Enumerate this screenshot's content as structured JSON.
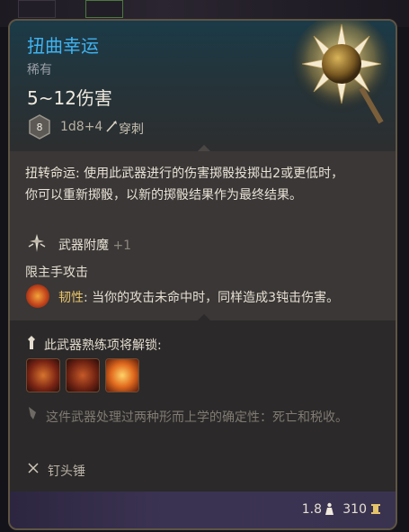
{
  "item": {
    "name": "扭曲幸运",
    "rarity": "稀有",
    "damage": "5~12伤害",
    "die_value": "8",
    "damage_dice": "1d8+4",
    "damage_type": "穿刺"
  },
  "passive": {
    "name": "扭转命运",
    "text": ": 使用此武器进行的伤害掷骰投掷出2或更低时，你可以重新掷骰，以新的掷骰结果作为最终结果。"
  },
  "enchantment": {
    "label": "武器附魔",
    "value": "+1"
  },
  "main_hand": "限主手攻击",
  "toughness": {
    "name": "韧性",
    "text": ": 当你的攻击未命中时，同样造成3钝击伤害。"
  },
  "proficiency": {
    "title": "此武器熟练项将解锁:"
  },
  "flavor": "这件武器处理过两种形而上学的确定性：死亡和税收。",
  "weapon_type": "钉头锤",
  "footer": {
    "weight": "1.8",
    "price": "310"
  },
  "icons": [
    "die-d8-icon",
    "pierce-icon",
    "enchant-icon",
    "toughness-icon",
    "proficiency-icon",
    "action-icon",
    "flavor-quill-icon",
    "crossed-swords-icon",
    "weight-icon",
    "coin-icon"
  ],
  "colors": {
    "title": "#3fb3f1",
    "keyword": "#e9c56a",
    "border": "#5e5544"
  }
}
